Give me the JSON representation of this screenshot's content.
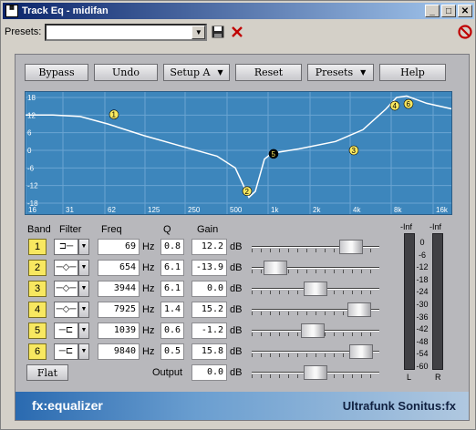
{
  "window": {
    "title": "Track Eq - midifan",
    "icon": "app-icon"
  },
  "presets_bar": {
    "label": "Presets:",
    "value": ""
  },
  "toolbar": {
    "bypass": "Bypass",
    "undo": "Undo",
    "setup": "Setup A",
    "reset": "Reset",
    "presets": "Presets",
    "help": "Help"
  },
  "graph": {
    "y_ticks": [
      "18",
      "12",
      "6",
      "0",
      "-6",
      "-12",
      "-18"
    ],
    "x_ticks": [
      "16",
      "31",
      "62",
      "125",
      "250",
      "500",
      "1k",
      "2k",
      "4k",
      "8k",
      "16k"
    ]
  },
  "headers": {
    "band": "Band",
    "filter": "Filter",
    "freq": "Freq",
    "q": "Q",
    "gain": "Gain"
  },
  "units": {
    "hz": "Hz",
    "db": "dB"
  },
  "bands": [
    {
      "id": "1",
      "filter": "low-shelf-icon",
      "freq": "69",
      "q": "0.8",
      "gain": "12.2",
      "slider": 0.84
    },
    {
      "id": "2",
      "filter": "peak-icon",
      "freq": "654",
      "q": "6.1",
      "gain": "-13.9",
      "slider": 0.11
    },
    {
      "id": "3",
      "filter": "peak-icon",
      "freq": "3944",
      "q": "6.1",
      "gain": "0.0",
      "slider": 0.5
    },
    {
      "id": "4",
      "filter": "peak-icon",
      "freq": "7925",
      "q": "1.4",
      "gain": "15.2",
      "slider": 0.92
    },
    {
      "id": "5",
      "filter": "high-shelf-icon",
      "freq": "1039",
      "q": "0.6",
      "gain": "-1.2",
      "slider": 0.47
    },
    {
      "id": "6",
      "filter": "high-shelf-icon",
      "freq": "9840",
      "q": "0.5",
      "gain": "15.8",
      "slider": 0.94
    }
  ],
  "output": {
    "label": "Output",
    "gain": "0.0",
    "slider": 0.5
  },
  "flat": "Flat",
  "meters": {
    "left_peak": "-Inf",
    "right_peak": "-Inf",
    "left": "L",
    "right": "R",
    "scale": [
      "0",
      "-6",
      "-12",
      "-18",
      "-24",
      "-30",
      "-36",
      "-42",
      "-48",
      "-54",
      "-60"
    ]
  },
  "footer": {
    "brand": "fx:equalizer",
    "vendor": "Ultrafunk Sonitus:fx"
  }
}
